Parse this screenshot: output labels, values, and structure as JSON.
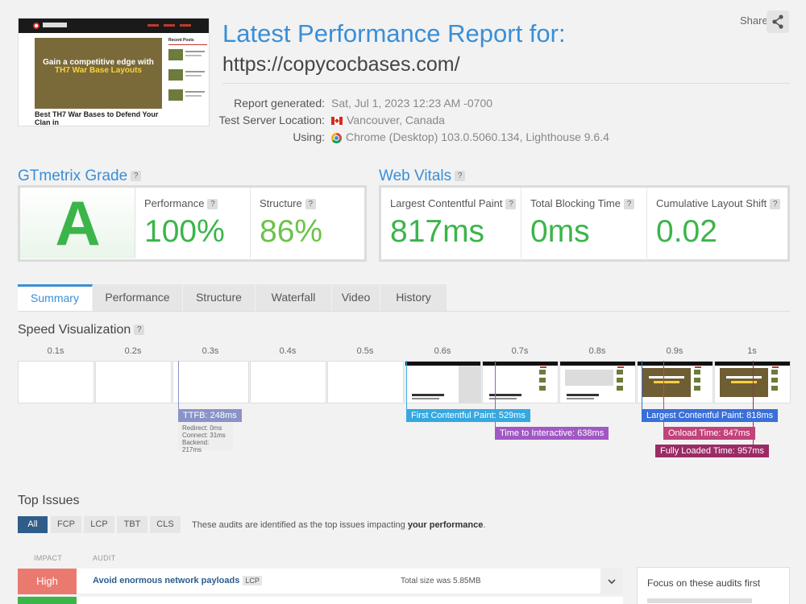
{
  "header": {
    "title": "Latest Performance Report for:",
    "url": "https://copycocbases.com/",
    "share_label": "Share"
  },
  "thumbnail": {
    "headline_part1": "Gain a competitive edge with ",
    "headline_highlight": "TH7 War Base Layouts",
    "caption": "Best TH7 War Bases to Defend Your Clan in",
    "sidebar_title": "Recent Posts"
  },
  "meta": {
    "report_generated_label": "Report generated:",
    "report_generated_value": "Sat, Jul 1, 2023 12:23 AM -0700",
    "server_label": "Test Server Location:",
    "server_value": "Vancouver, Canada",
    "using_label": "Using:",
    "using_value": "Chrome (Desktop) 103.0.5060.134, Lighthouse 9.6.4"
  },
  "grade": {
    "title": "GTmetrix Grade",
    "letter": "A",
    "performance_label": "Performance",
    "performance_value": "100%",
    "structure_label": "Structure",
    "structure_value": "86%"
  },
  "vitals": {
    "title": "Web Vitals",
    "lcp_label": "Largest Contentful Paint",
    "lcp_value": "817ms",
    "tbt_label": "Total Blocking Time",
    "tbt_value": "0ms",
    "cls_label": "Cumulative Layout Shift",
    "cls_value": "0.02"
  },
  "tabs": [
    "Summary",
    "Performance",
    "Structure",
    "Waterfall",
    "Video",
    "History"
  ],
  "speed": {
    "title": "Speed Visualization",
    "ticks": [
      "0.1s",
      "0.2s",
      "0.3s",
      "0.4s",
      "0.5s",
      "0.6s",
      "0.7s",
      "0.8s",
      "0.9s",
      "1s"
    ],
    "ttfb": "TTFB: 248ms",
    "redirect": "Redirect: 0ms",
    "connect": "Connect: 31ms",
    "backend": "Backend: 217ms",
    "fcp": "First Contentful Paint: 529ms",
    "tti": "Time to Interactive: 638ms",
    "lcp": "Largest Contentful Paint: 818ms",
    "onload": "Onload Time: 847ms",
    "fully_loaded": "Fully Loaded Time: 957ms",
    "colors": {
      "ttfb": "#8a93c7",
      "fcp": "#35a8e0",
      "tti": "#a158c4",
      "lcp": "#3a6fd8",
      "onload": "#c2427a",
      "fully_loaded": "#9b2b65"
    }
  },
  "top_issues": {
    "title": "Top Issues",
    "filters": [
      "All",
      "FCP",
      "LCP",
      "TBT",
      "CLS"
    ],
    "note_prefix": "These audits are identified as the top issues impacting ",
    "note_bold": "your performance",
    "note_suffix": ".",
    "col_impact": "IMPACT",
    "col_audit": "AUDIT",
    "issue1_impact": "High",
    "issue1_name": "Avoid enormous network payloads",
    "issue1_badge": "LCP",
    "issue1_detail": "Total size was 5.85MB",
    "focus_title": "Focus on these audits first"
  }
}
